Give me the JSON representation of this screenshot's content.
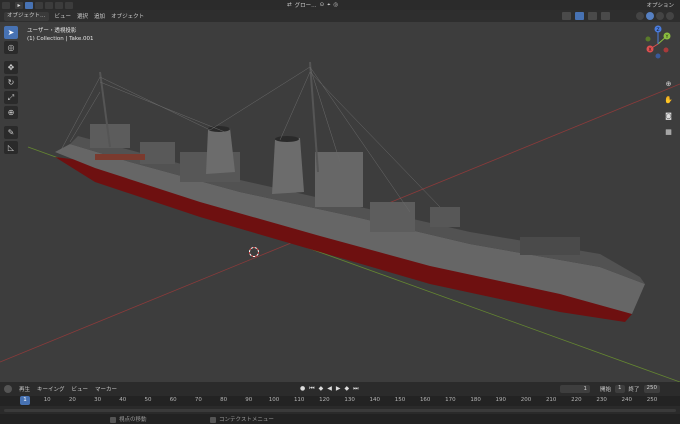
{
  "topbar": {
    "transform_orientation": "グロー…",
    "options_label": "オプション"
  },
  "viewport_header": {
    "mode_label": "オブジェクト…",
    "menus": [
      "ビュー",
      "選択",
      "追加",
      "オブジェクト"
    ]
  },
  "viewport": {
    "view_name": "ユーザー・透視投影",
    "object_path": "(1) Collection | Take.001",
    "gizmo_axes": {
      "x": "X",
      "y": "Y",
      "z": "Z"
    },
    "colors": {
      "background": "#3d3d3d",
      "x_axis": "#d9534f",
      "y_axis": "#8cbf3f",
      "hull_red": "#7a1212",
      "hull_grey": "#6b6b6b"
    }
  },
  "toolbar": {
    "tools": [
      "select-icon",
      "cursor-icon",
      "move-icon",
      "rotate-icon",
      "scale-icon",
      "transform-icon",
      "annotate-icon",
      "measure-icon"
    ]
  },
  "nav": {
    "buttons": [
      "zoom-icon",
      "hand-icon",
      "camera-icon",
      "grid-icon"
    ]
  },
  "timeline": {
    "menus": [
      "再生",
      "キーイング",
      "ビュー",
      "マーカー"
    ],
    "current_frame": "1",
    "start_label": "開始",
    "start_value": "1",
    "end_label": "終了",
    "end_value": "250",
    "ruler_ticks": [
      "1",
      "10",
      "20",
      "30",
      "40",
      "50",
      "60",
      "70",
      "80",
      "90",
      "100",
      "110",
      "120",
      "130",
      "140",
      "150",
      "160",
      "170",
      "180",
      "190",
      "200",
      "210",
      "220",
      "230",
      "240",
      "250"
    ],
    "ruler_cursor": "1"
  },
  "status": {
    "item1": "視点の移動",
    "item2": "コンテクストメニュー"
  }
}
